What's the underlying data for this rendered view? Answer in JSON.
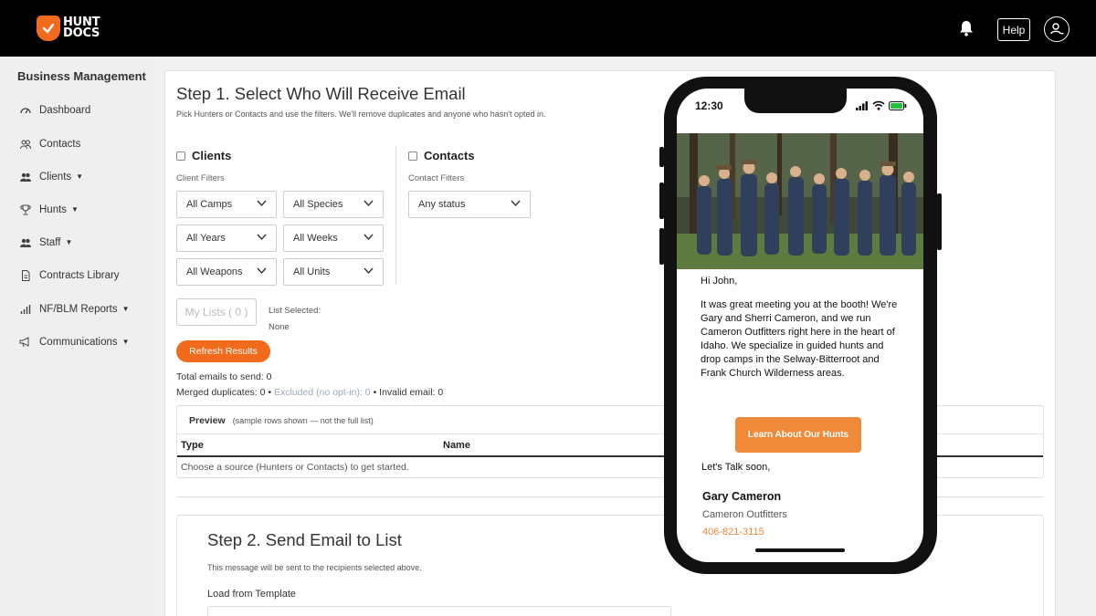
{
  "app": {
    "logo_line1": "HUNT",
    "logo_line2": "DOCS"
  },
  "topbar": {
    "help_label": "Help"
  },
  "colors": {
    "accent": "#f26a1b",
    "cta": "#f08a3b",
    "topbar": "#000000"
  },
  "sidebar": {
    "title": "Business Management",
    "items": [
      {
        "label": "Dashboard",
        "icon": "dashboard-icon",
        "caret": false
      },
      {
        "label": "Contacts",
        "icon": "contacts-icon",
        "caret": false
      },
      {
        "label": "Clients",
        "icon": "clients-icon",
        "caret": true
      },
      {
        "label": "Hunts",
        "icon": "trophy-icon",
        "caret": true
      },
      {
        "label": "Staff",
        "icon": "staff-icon",
        "caret": true
      },
      {
        "label": "Contracts Library",
        "icon": "document-icon",
        "caret": false
      },
      {
        "label": "NF/BLM Reports",
        "icon": "bar-chart-icon",
        "caret": true
      },
      {
        "label": "Communications",
        "icon": "megaphone-icon",
        "caret": true
      }
    ]
  },
  "step1": {
    "title": "Step 1. Select Who Will Receive Email",
    "subtitle": "Pick Hunters or Contacts and use the filters. We'll remove duplicates and anyone who hasn't opted in.",
    "clients": {
      "label": "Clients",
      "filters_label": "Client Filters",
      "selects": [
        "All Camps",
        "All Species",
        "All Years",
        "All Weeks",
        "All Weapons",
        "All Units"
      ]
    },
    "contacts": {
      "label": "Contacts",
      "filters_label": "Contact Filters",
      "status_select": "Any status"
    },
    "my_lists_label": "My Lists ( 0 )",
    "list_selected_label": "List Selected:",
    "list_selected_value": "None",
    "refresh_label": "Refresh Results",
    "total_emails": "Total emails to send: 0",
    "merged_duplicates": "Merged duplicates: 0",
    "excluded": "Excluded (no opt-in): 0",
    "invalid_email": "Invalid email: 0",
    "preview": {
      "title": "Preview",
      "note": "(sample rows shown — not the full list)",
      "columns": [
        "Type",
        "Name"
      ],
      "empty_message": "Choose a source (Hunters or Contacts) to get started."
    }
  },
  "step2": {
    "title": "Step 2. Send Email to List",
    "subtitle": "This message will be sent to the recipients selected above.",
    "template_label": "Load from Template"
  },
  "phone": {
    "time": "12:30",
    "greeting": "Hi John,",
    "body": "It was great meeting you at the booth! We're Gary and Sherri Cameron, and we run Cameron Outfitters right here in the heart of Idaho. We specialize in guided hunts and drop camps in the Selway-Bitterroot and Frank Church Wilderness areas.",
    "cta_label": "Learn About Our Hunts",
    "closing": "Let's Talk soon,",
    "signature_name": "Gary Cameron",
    "signature_company": "Cameron Outfitters",
    "signature_phone": "406-821-3115"
  }
}
